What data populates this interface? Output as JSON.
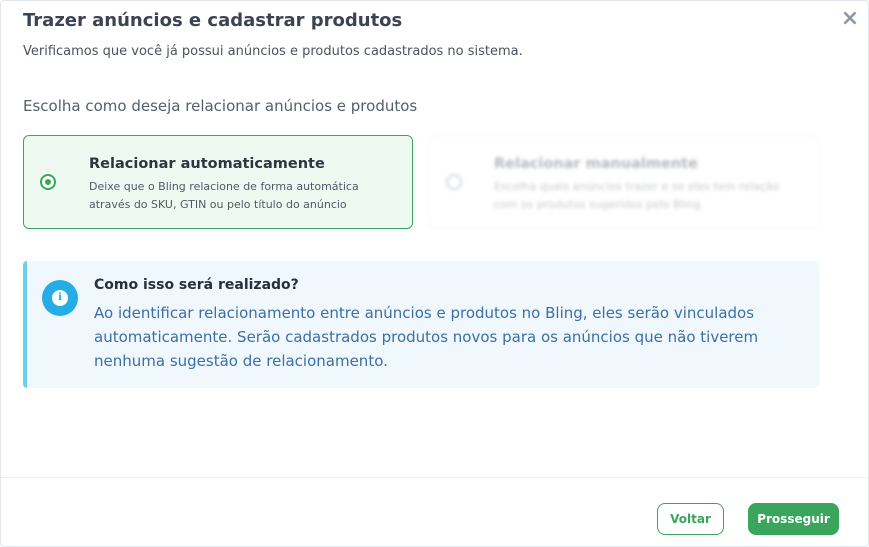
{
  "modal": {
    "title": "Trazer anúncios e cadastrar produtos",
    "close_icon": "×",
    "subtitle": "Verificamos que você já possui anúncios e produtos cadastrados no sistema.",
    "choose_label": "Escolha como deseja relacionar anúncios e produtos"
  },
  "options": [
    {
      "title": "Relacionar automaticamente",
      "description": "Deixe que o Bling relacione de forma automática através do SKU, GTIN ou pelo título do anúncio",
      "selected": true
    },
    {
      "title": "Relacionar manualmente",
      "description": "Escolha quais anúncios trazer e se eles tem relação com os produtos sugeridos pelo Bling",
      "selected": false
    }
  ],
  "info": {
    "icon": "i",
    "title": "Como isso será realizado?",
    "body": "Ao identificar relacionamento entre anúncios e produtos no Bling, eles serão vinculados automaticamente. Serão cadastrados produtos novos para os anúncios que não tiverem nenhuma sugestão de relacionamento."
  },
  "footer": {
    "back_label": "Voltar",
    "next_label": "Prosseguir"
  },
  "colors": {
    "accent_green": "#3aa55c",
    "info_blue": "#25aee6",
    "info_bg": "#f0f8fd"
  }
}
